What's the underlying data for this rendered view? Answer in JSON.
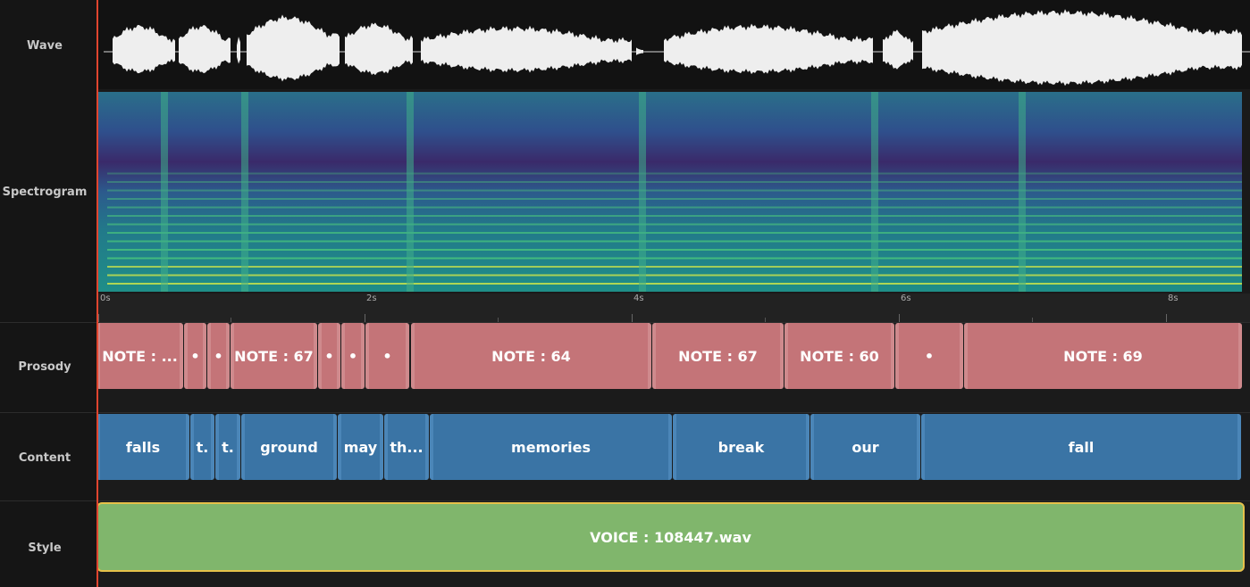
{
  "tracks": {
    "wave": "Wave",
    "spectrogram": "Spectrogram",
    "prosody": "Prosody",
    "content": "Content",
    "style": "Style"
  },
  "ruler": {
    "ticks": [
      "0s",
      "2s",
      "4s",
      "6s",
      "8s"
    ]
  },
  "prosody_segments": [
    {
      "label": "NOTE : ..."
    },
    {
      "label": "•"
    },
    {
      "label": "•"
    },
    {
      "label": "NOTE : 67"
    },
    {
      "label": "•"
    },
    {
      "label": "•"
    },
    {
      "label": "•"
    },
    {
      "label": "NOTE : 64"
    },
    {
      "label": "NOTE : 67"
    },
    {
      "label": "NOTE : 60"
    },
    {
      "label": "•"
    },
    {
      "label": "NOTE : 69"
    }
  ],
  "content_segments": [
    {
      "label": "falls"
    },
    {
      "label": "t."
    },
    {
      "label": "t."
    },
    {
      "label": "ground"
    },
    {
      "label": "may"
    },
    {
      "label": "th..."
    },
    {
      "label": "memories"
    },
    {
      "label": "break"
    },
    {
      "label": "our"
    },
    {
      "label": "fall"
    }
  ],
  "style_segment": {
    "label": "VOICE : 108447.wav"
  },
  "colors": {
    "prosody": "#c47478",
    "content": "#3a74a5",
    "style": "#80b66c",
    "style_border": "#e6c14a",
    "playhead": "#e0452f"
  }
}
